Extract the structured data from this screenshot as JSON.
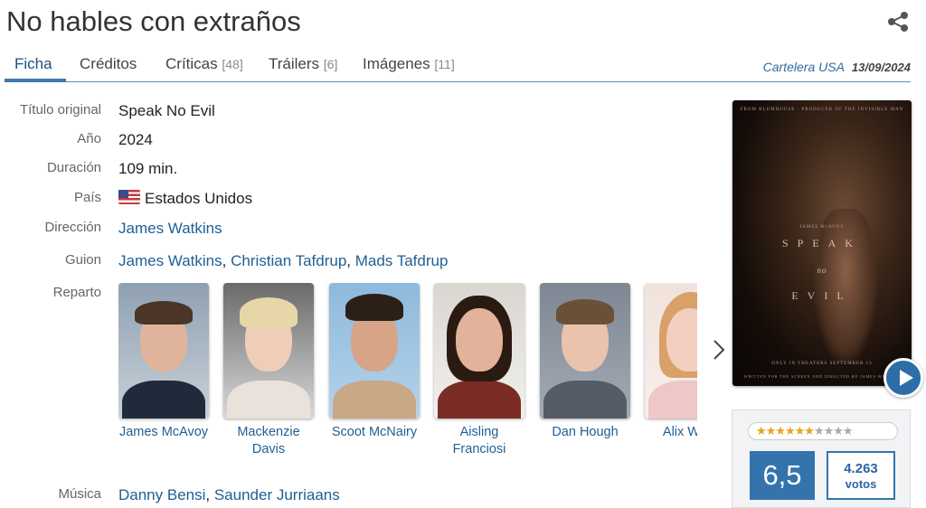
{
  "title": "No hables con extraños",
  "tabs": [
    {
      "label": "Ficha",
      "count": ""
    },
    {
      "label": "Créditos",
      "count": ""
    },
    {
      "label": "Críticas",
      "count": "[48]"
    },
    {
      "label": "Tráilers",
      "count": "[6]"
    },
    {
      "label": "Imágenes",
      "count": "[11]"
    }
  ],
  "release": {
    "place": "Cartelera USA",
    "date": "13/09/2024"
  },
  "details": {
    "original_title_label": "Título original",
    "original_title": "Speak No Evil",
    "year_label": "Año",
    "year": "2024",
    "duration_label": "Duración",
    "duration": "109 min.",
    "country_label": "País",
    "country": "Estados Unidos",
    "director_label": "Dirección",
    "director": "James Watkins",
    "script_label": "Guion",
    "script": [
      "James Watkins",
      "Christian Tafdrup",
      "Mads Tafdrup"
    ],
    "cast_label": "Reparto",
    "music_label": "Música",
    "music": [
      "Danny Bensi",
      "Saunder Jurriaans"
    ]
  },
  "cast": [
    {
      "line1": "James McAvoy",
      "line2": ""
    },
    {
      "line1": "Mackenzie",
      "line2": "Davis"
    },
    {
      "line1": "Scoot McNairy",
      "line2": ""
    },
    {
      "line1": "Aisling",
      "line2": "Franciosi"
    },
    {
      "line1": "Dan Hough",
      "line2": ""
    },
    {
      "line1": "Alix West",
      "line2": ""
    }
  ],
  "poster": {
    "top_small": "FROM BLUMHOUSE · PRODUCER OF THE INVISIBLE MAN",
    "actor": "JAMES McAVOY",
    "word1": "SPEAK",
    "word2": "no",
    "word3": "EVIL",
    "bottom_small": "ONLY IN THEATERS SEPTEMBER 13",
    "credit_small": "WRITTEN FOR THE SCREEN AND DIRECTED BY JAMES WATKINS"
  },
  "rating": {
    "stars_on": "★★★★★★",
    "stars_off": "★★★★",
    "score": "6,5",
    "votes": "4.263",
    "votes_label": "votos"
  },
  "colors": {
    "accent": "#3573ac",
    "link": "#1f5f94",
    "star": "#e8a21a"
  }
}
